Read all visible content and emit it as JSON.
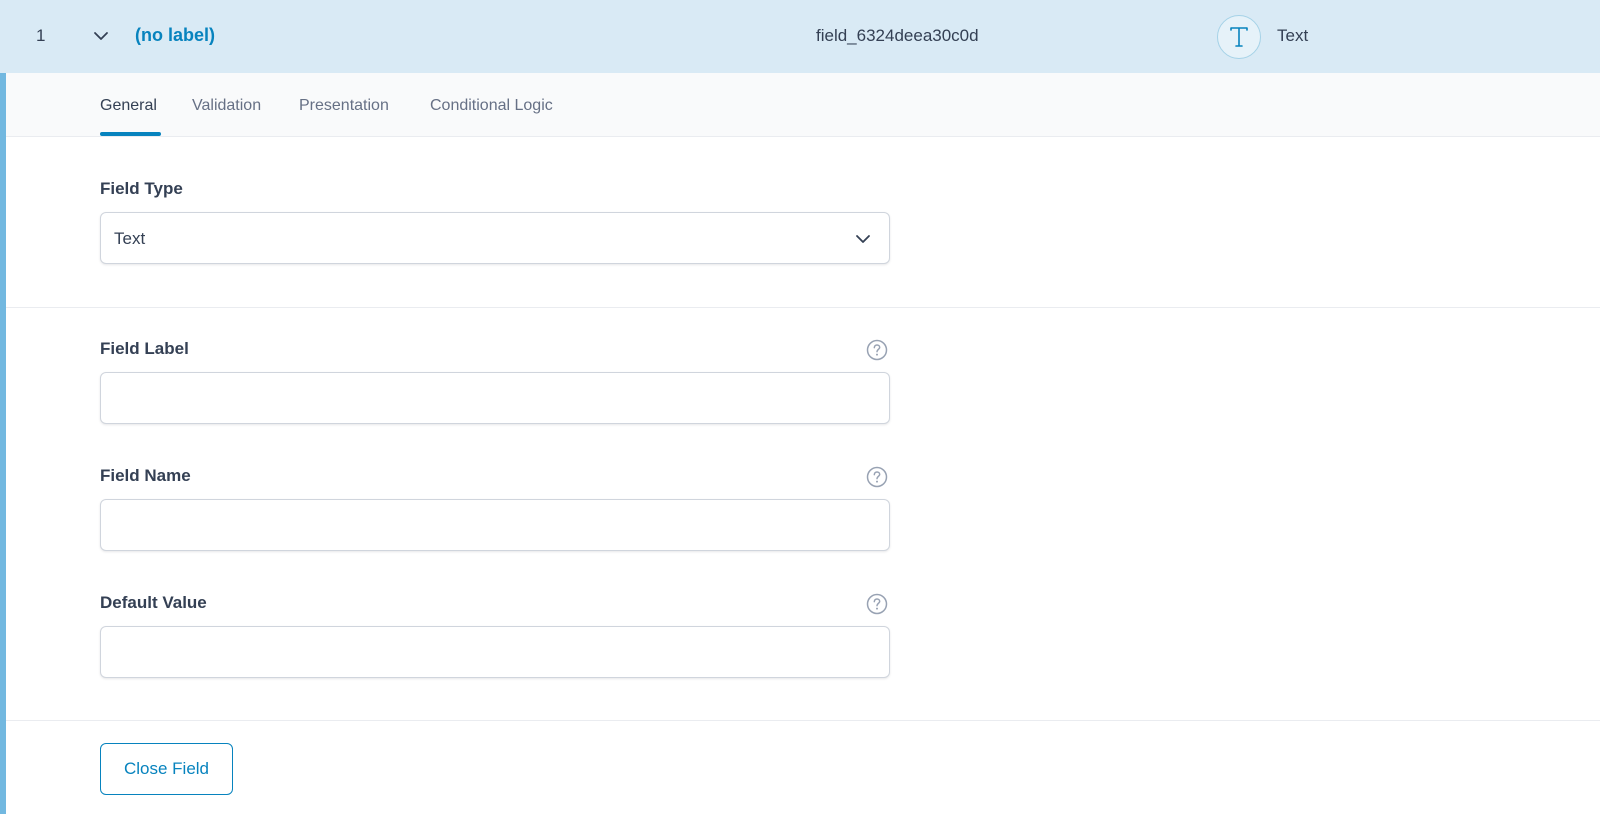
{
  "header": {
    "order": "1",
    "label": "(no label)",
    "key": "field_6324deea30c0d",
    "type_icon": "text-type-icon",
    "type": "Text"
  },
  "tabs": [
    {
      "label": "General",
      "active": true
    },
    {
      "label": "Validation",
      "active": false
    },
    {
      "label": "Presentation",
      "active": false
    },
    {
      "label": "Conditional Logic",
      "active": false
    }
  ],
  "fields": {
    "field_type": {
      "label": "Field Type",
      "value": "Text"
    },
    "field_label": {
      "label": "Field Label",
      "value": ""
    },
    "field_name": {
      "label": "Field Name",
      "value": ""
    },
    "default_value": {
      "label": "Default Value",
      "value": ""
    }
  },
  "footer": {
    "close_label": "Close Field"
  },
  "colors": {
    "accent": "#0783be",
    "header_bg": "#d9eaf5",
    "left_accent": "#72b8e0"
  }
}
